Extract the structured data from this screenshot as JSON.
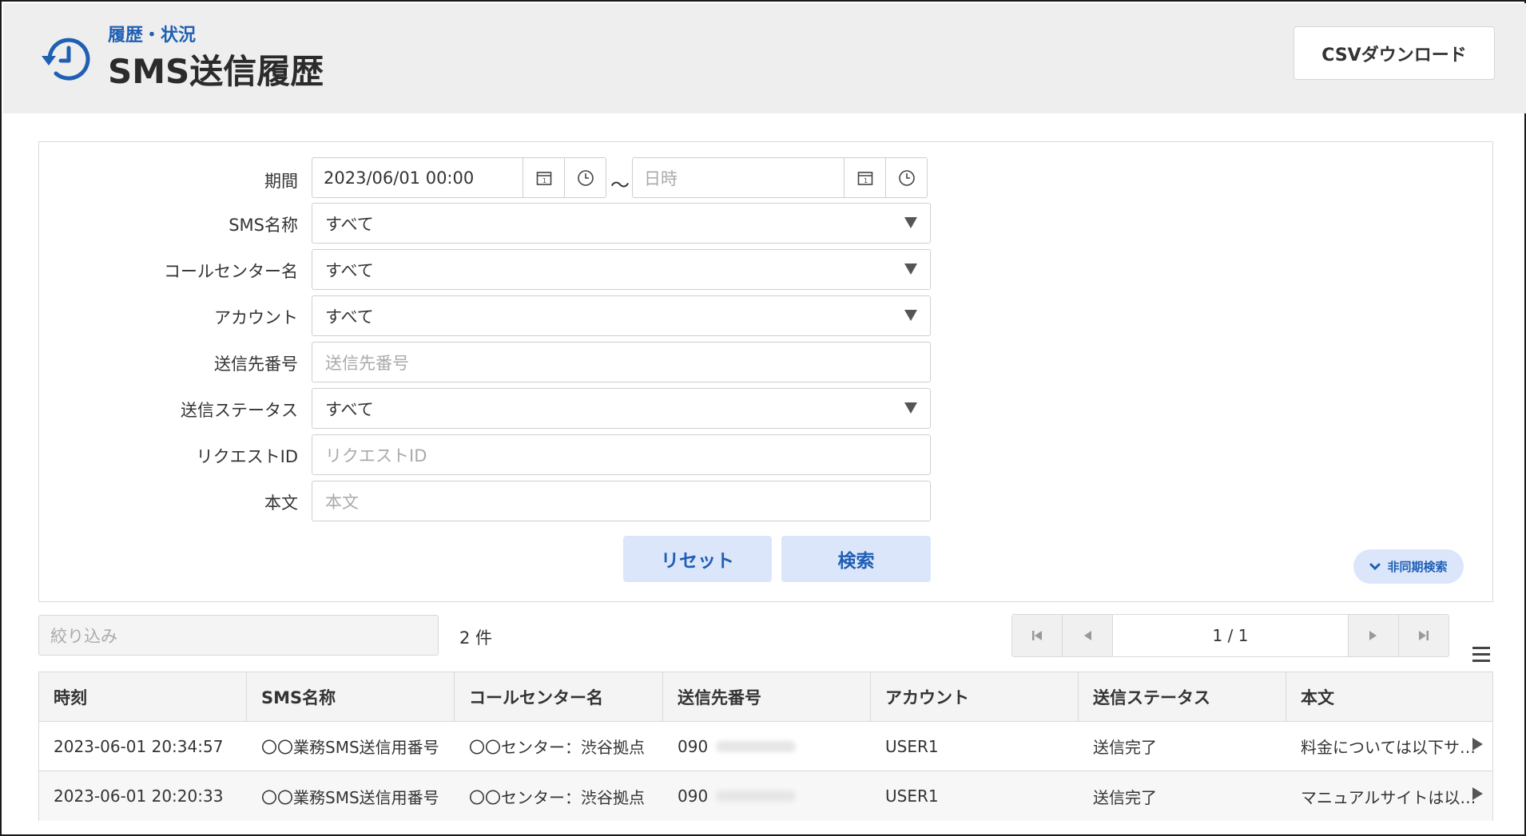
{
  "header": {
    "breadcrumb": "履歴・状況",
    "title": "SMS送信履歴",
    "csv_button": "CSVダウンロード"
  },
  "search": {
    "period_label": "期間",
    "period_from": "2023/06/01 00:00",
    "period_to_placeholder": "日時",
    "tilde": "～",
    "sms_name_label": "SMS名称",
    "sms_name_value": "すべて",
    "call_center_label": "コールセンター名",
    "call_center_value": "すべて",
    "account_label": "アカウント",
    "account_value": "すべて",
    "destination_label": "送信先番号",
    "destination_placeholder": "送信先番号",
    "status_label": "送信ステータス",
    "status_value": "すべて",
    "request_id_label": "リクエストID",
    "request_id_placeholder": "リクエストID",
    "body_label": "本文",
    "body_placeholder": "本文",
    "reset_button": "リセット",
    "search_button": "検索",
    "async_button": "非同期検索"
  },
  "list": {
    "filter_placeholder": "絞り込み",
    "count": "2 件",
    "page": "1 / 1"
  },
  "table": {
    "headers": [
      "時刻",
      "SMS名称",
      "コールセンター名",
      "送信先番号",
      "アカウント",
      "送信ステータス",
      "本文"
    ],
    "rows": [
      [
        "2023-06-01 20:34:57",
        "〇〇業務SMS送信用番号",
        "〇〇センター：渋谷拠点",
        "090",
        "USER1",
        "送信完了",
        "料金については以下サ…"
      ],
      [
        "2023-06-01 20:20:33",
        "〇〇業務SMS送信用番号",
        "〇〇センター：渋谷拠点",
        "090",
        "USER1",
        "送信完了",
        "マニュアルサイトは以…"
      ]
    ]
  },
  "colors": {
    "accent": "#1f5fb4",
    "button_bg": "#dce6fb",
    "header_bg": "#eeeeee"
  }
}
